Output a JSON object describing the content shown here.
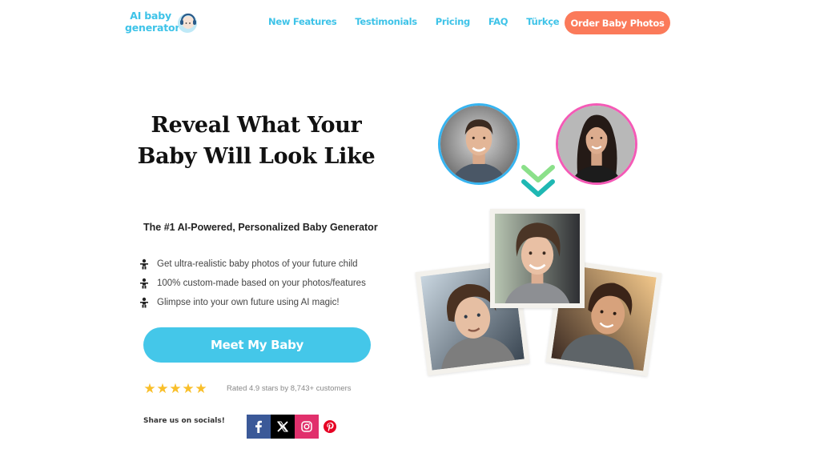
{
  "header": {
    "logo": {
      "line1": "AI baby",
      "line2": "generator",
      "icon": "baby-headphones-icon"
    },
    "nav": [
      {
        "label": "New Features"
      },
      {
        "label": "Testimonials"
      },
      {
        "label": "Pricing"
      },
      {
        "label": "FAQ"
      },
      {
        "label": "Türkçe"
      }
    ],
    "order_button": "Order Baby Photos"
  },
  "hero": {
    "title": "Reveal What Your Baby Will Look Like",
    "subtitle": "The #1 AI-Powered, Personalized Baby Generator",
    "bullets": [
      {
        "icon": "baby-icon",
        "text": "Get ultra-realistic baby photos of your future child"
      },
      {
        "icon": "baby-icon",
        "text": "100% custom-made based on your photos/features"
      },
      {
        "icon": "baby-icon",
        "text": "Glimpse into your own future using AI magic!"
      }
    ],
    "cta": "Meet My Baby",
    "rating": {
      "stars": 5,
      "max_stars": 5,
      "text": "Rated 4.9 stars by 8,743+ customers"
    },
    "share": {
      "label": "Share us on socials!",
      "networks": [
        {
          "name": "facebook",
          "icon": "facebook-icon",
          "color": "#3b5998"
        },
        {
          "name": "x",
          "icon": "x-icon",
          "color": "#000000"
        },
        {
          "name": "instagram",
          "icon": "instagram-icon",
          "color": "#e1306c"
        },
        {
          "name": "pinterest",
          "icon": "pinterest-icon",
          "color": "#e60023"
        }
      ]
    }
  },
  "visual": {
    "parents": [
      {
        "name": "father-photo",
        "border_color": "#37b4f0"
      },
      {
        "name": "mother-photo",
        "border_color": "#f45ab6"
      }
    ],
    "arrow_colors": [
      "#8be08a",
      "#1fb8b3"
    ],
    "children_photos": 3
  },
  "colors": {
    "brand": "#3ec3e8",
    "cta": "#44c7e9",
    "order_button": "#fb7a5a",
    "stars": "#f9bf2a"
  }
}
